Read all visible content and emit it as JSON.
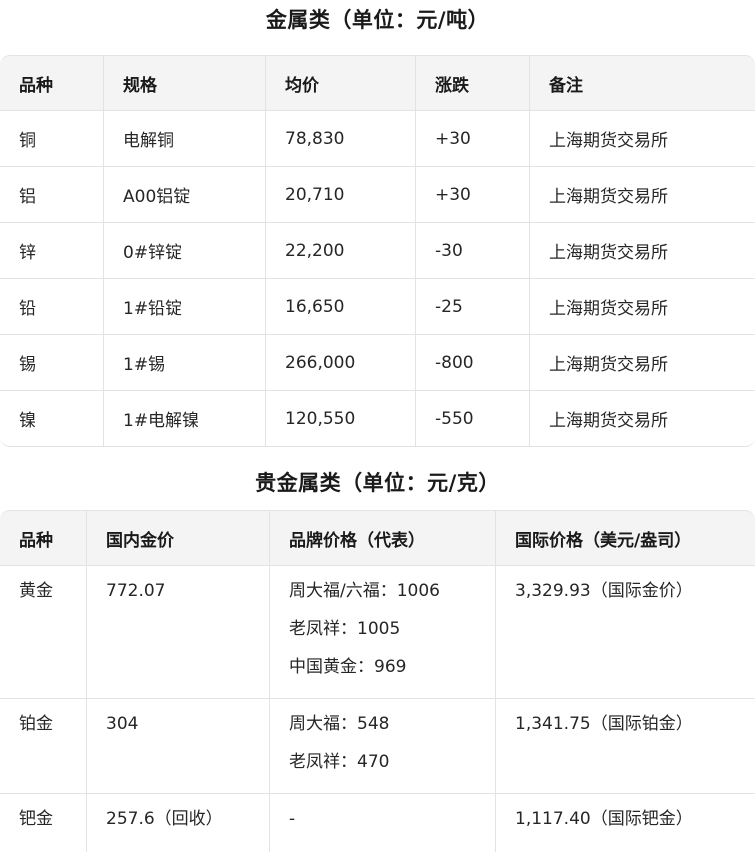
{
  "metals": {
    "title": "金属类（单位：元/吨）",
    "headers": [
      "品种",
      "规格",
      "均价",
      "涨跌",
      "备注"
    ],
    "rows": [
      [
        "铜",
        "电解铜",
        "78,830",
        "+30",
        "上海期货交易所"
      ],
      [
        "铝",
        "A00铝锭",
        "20,710",
        "+30",
        "上海期货交易所"
      ],
      [
        "锌",
        "0#锌锭",
        "22,200",
        "-30",
        "上海期货交易所"
      ],
      [
        "铅",
        "1#铅锭",
        "16,650",
        "-25",
        "上海期货交易所"
      ],
      [
        "锡",
        "1#锡",
        "266,000",
        "-800",
        "上海期货交易所"
      ],
      [
        "镍",
        "1#电解镍",
        "120,550",
        "-550",
        "上海期货交易所"
      ]
    ]
  },
  "precious": {
    "title": "贵金属类（单位：元/克）",
    "headers": [
      "品种",
      "国内金价",
      "品牌价格（代表）",
      "国际价格（美元/盎司）"
    ],
    "rows": [
      {
        "variety": "黄金",
        "domestic": "772.07",
        "brands": [
          "周大福/六福：1006",
          "老凤祥：1005",
          "中国黄金：969"
        ],
        "international": "3,329.93（国际金价）"
      },
      {
        "variety": "铂金",
        "domestic": "304",
        "brands": [
          "周大福：548",
          "老凤祥：470"
        ],
        "international": "1,341.75（国际铂金）"
      },
      {
        "variety": "钯金",
        "domestic": "257.6（回收）",
        "brands": [
          "-"
        ],
        "international": "1,117.40（国际钯金）"
      }
    ]
  }
}
